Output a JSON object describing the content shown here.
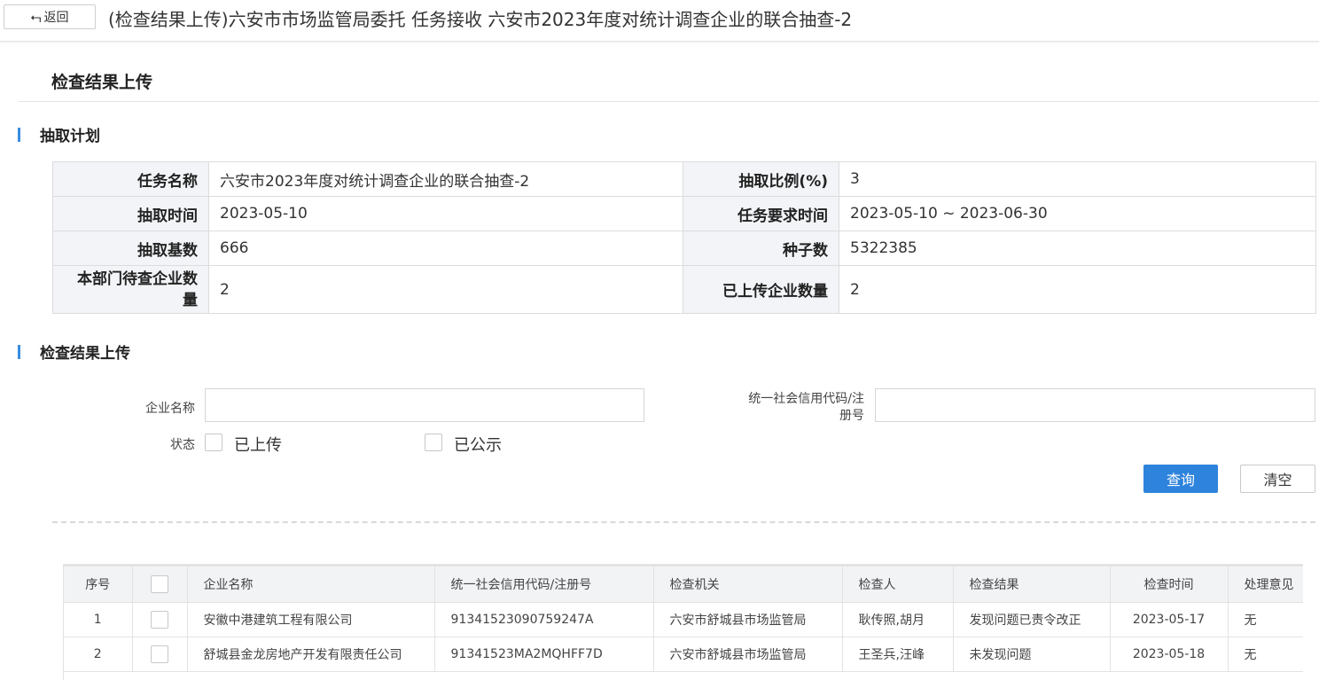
{
  "topbar": {
    "back_label": "返回",
    "back_icon": "return-arrow-icon",
    "title": "(检查结果上传)六安市市场监管局委托 任务接收 六安市2023年度对统计调查企业的联合抽查-2"
  },
  "page_heading": "检查结果上传",
  "plan": {
    "section_title": "抽取计划",
    "rows": [
      {
        "l1": "任务名称",
        "v1": "六安市2023年度对统计调查企业的联合抽查-2",
        "l2": "抽取比例(%)",
        "v2": "3"
      },
      {
        "l1": "抽取时间",
        "v1": "2023-05-10",
        "l2": "任务要求时间",
        "v2": "2023-05-10 ~ 2023-06-30"
      },
      {
        "l1": "抽取基数",
        "v1": "666",
        "l2": "种子数",
        "v2": "5322385"
      },
      {
        "l1": "本部门待查企业数量",
        "v1": "2",
        "l2": "已上传企业数量",
        "v2": "2"
      }
    ]
  },
  "upload": {
    "section_title": "检查结果上传",
    "company_label": "企业名称",
    "company_value": "",
    "credit_label_line1": "统一社会信用代码/注",
    "credit_label_line2": "册号",
    "credit_value": "",
    "status_label": "状态",
    "status_opt1": "已上传",
    "status_opt2": "已公示",
    "query_label": "查询",
    "clear_label": "清空"
  },
  "results": {
    "headers": [
      "序号",
      "",
      "企业名称",
      "统一社会信用代码/注册号",
      "检查机关",
      "检查人",
      "检查结果",
      "检查时间",
      "处理意见"
    ],
    "rows": [
      [
        "1",
        "",
        "安徽中港建筑工程有限公司",
        "91341523090759247A",
        "六安市舒城县市场监管局",
        "耿传照,胡月",
        "发现问题已责令改正",
        "2023-05-17",
        "无"
      ],
      [
        "2",
        "",
        "舒城县金龙房地产开发有限责任公司",
        "91341523MA2MQHFF7D",
        "六安市舒城县市场监管局",
        "王圣兵,汪峰",
        "未发现问题",
        "2023-05-18",
        "无"
      ]
    ]
  },
  "colors": {
    "accent": "#2e83dc",
    "section_bar": "#3a8de0",
    "label_bg": "#f2f4f7"
  }
}
